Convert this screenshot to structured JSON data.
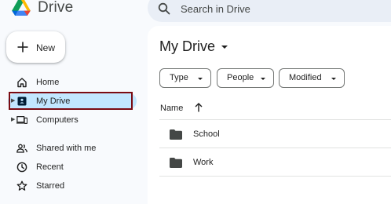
{
  "app": {
    "title": "Drive"
  },
  "search": {
    "placeholder": "Search in Drive"
  },
  "sidebar": {
    "new_label": "New",
    "items": [
      {
        "label": "Home",
        "icon": "home-icon"
      },
      {
        "label": "My Drive",
        "icon": "my-drive-icon",
        "expandable": true,
        "active": true
      },
      {
        "label": "Computers",
        "icon": "computers-icon",
        "expandable": true
      },
      {
        "label": "Shared with me",
        "icon": "shared-icon"
      },
      {
        "label": "Recent",
        "icon": "clock-icon"
      },
      {
        "label": "Starred",
        "icon": "star-icon"
      }
    ]
  },
  "main": {
    "title": "My Drive",
    "filters": [
      {
        "label": "Type"
      },
      {
        "label": "People"
      },
      {
        "label": "Modified"
      }
    ],
    "column_name": "Name",
    "rows": [
      {
        "name": "School",
        "icon": "folder-icon"
      },
      {
        "name": "Work",
        "icon": "folder-icon"
      }
    ]
  },
  "colors": {
    "active_bg": "#c2e7ff",
    "highlight_border": "#7a0b12",
    "search_bg": "#e9eef6",
    "sidebar_bg": "#f8fafd"
  }
}
